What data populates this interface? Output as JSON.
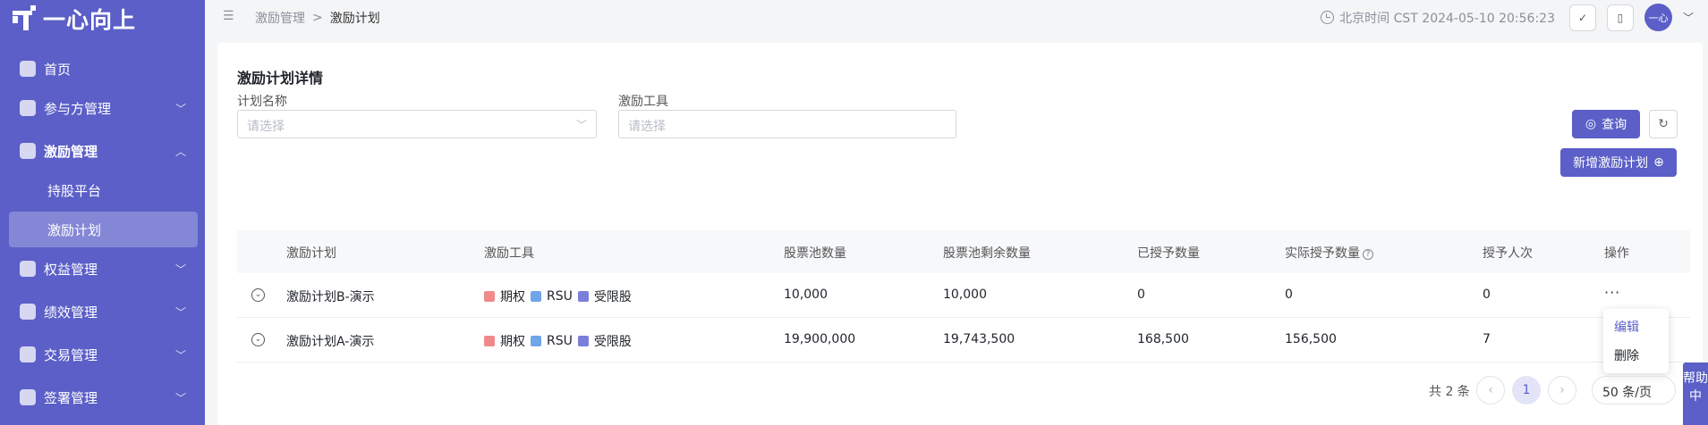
{
  "app": {
    "logo_text": "一心向上"
  },
  "sidebar": {
    "items": [
      {
        "label": "首页",
        "icon": "home-icon"
      },
      {
        "label": "参与方管理",
        "icon": "participants-icon"
      },
      {
        "label": "激励管理",
        "icon": "incentive-icon"
      },
      {
        "label": "权益管理",
        "icon": "equity-icon"
      },
      {
        "label": "绩效管理",
        "icon": "performance-icon"
      },
      {
        "label": "交易管理",
        "icon": "trade-icon"
      },
      {
        "label": "签署管理",
        "icon": "sign-icon"
      }
    ],
    "sub_items": [
      {
        "label": "持股平台"
      },
      {
        "label": "激励计划"
      }
    ]
  },
  "breadcrumb": {
    "parent": "激励管理",
    "sep": ">",
    "current": "激励计划"
  },
  "topbar": {
    "time": "北京时间 CST 2024-05-10 20:56:23",
    "avatar_text": "一心"
  },
  "page": {
    "title": "激励计划详情"
  },
  "filters": {
    "plan_name_label": "计划名称",
    "plan_name_placeholder": "请选择",
    "tool_label": "激励工具",
    "tool_placeholder": "请选择",
    "query_label": "查询",
    "add_label": "新增激励计划"
  },
  "table": {
    "headers": [
      "激励计划",
      "激励工具",
      "股票池数量",
      "股票池剩余数量",
      "已授予数量",
      "实际授予数量",
      "授予人次",
      "操作"
    ],
    "tools": [
      {
        "label": "期权",
        "color": "#f08a8a"
      },
      {
        "label": "RSU",
        "color": "#6fa6e8"
      },
      {
        "label": "受限股",
        "color": "#7b7fd9"
      }
    ],
    "rows": [
      {
        "plan": "激励计划B-演示",
        "pool": "10,000",
        "remaining": "10,000",
        "granted": "0",
        "actual": "0",
        "people": "0",
        "actions": "···"
      },
      {
        "plan": "激励计划A-演示",
        "pool": "19,900,000",
        "remaining": "19,743,500",
        "granted": "168,500",
        "actual": "156,500",
        "people": "7",
        "actions": ""
      }
    ]
  },
  "action_menu": {
    "edit": "编辑",
    "delete": "删除"
  },
  "pagination": {
    "total": "共 2 条",
    "current": "1",
    "page_size": "50 条/页"
  },
  "help": {
    "label": "帮助中"
  }
}
